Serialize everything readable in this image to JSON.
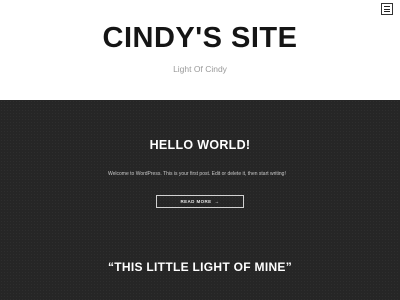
{
  "header": {
    "site_title": "CINDY'S SITE",
    "tagline": "Light Of Cindy",
    "menu_icon": "menu-icon"
  },
  "posts": [
    {
      "title": "HELLO WORLD!",
      "excerpt": "Welcome to WordPress. This is your first post. Edit or delete it, then start writing!",
      "read_more_label": "READ MORE",
      "read_more_arrow": "→"
    },
    {
      "title": "“THIS LITTLE LIGHT OF MINE”"
    }
  ],
  "colors": {
    "dark_background": "#262626",
    "text_light": "#ffffff",
    "title_dark": "#151515"
  }
}
